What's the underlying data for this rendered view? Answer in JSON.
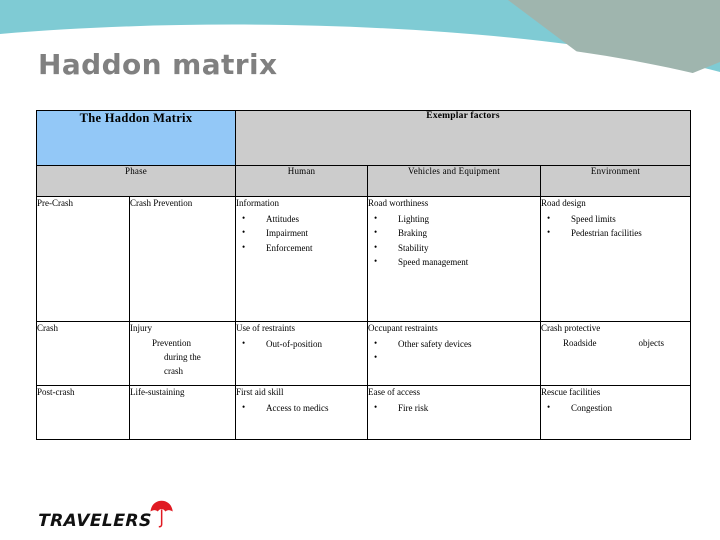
{
  "slide": {
    "title": "Haddon matrix"
  },
  "theme": {
    "teal": "#7FCBD4",
    "sage": "#9FB5AE",
    "taupe": "#CFCABA",
    "header_blue": "#93C8F7",
    "header_gray": "#CCCCCC",
    "title_gray": "#808080",
    "logo_red": "#E01A22"
  },
  "table": {
    "corner_label": "The Haddon Matrix",
    "exemplar_label": "Exemplar factors",
    "subheaders": [
      "Phase",
      "Human",
      "Vehicles and Equipment",
      "Environment"
    ],
    "rows": [
      {
        "phase": "Pre-Crash",
        "phase_detail": "Crash Prevention",
        "human": {
          "head": "Information",
          "bullets": [
            "Attitudes",
            "Impairment",
            "Enforcement"
          ]
        },
        "vehicles": {
          "head": "Road worthiness",
          "bullets": [
            "Lighting",
            "Braking",
            "Stability",
            "Speed management"
          ]
        },
        "environment": {
          "head": "Road design",
          "bullets": [
            "Speed limits",
            "Pedestrian facilities"
          ]
        }
      },
      {
        "phase": "Crash",
        "phase_detail_lines": [
          "Injury",
          "Prevention",
          "during the",
          "crash"
        ],
        "human": {
          "head": "Use of restraints",
          "bullets": [
            "Out-of-position"
          ]
        },
        "vehicles": {
          "head": "Occupant restraints",
          "bullets": [
            "Other safety devices",
            ""
          ]
        },
        "environment": {
          "head": "Crash protective",
          "sub_left": "Roadside",
          "sub_right": "objects"
        }
      },
      {
        "phase": "Post-crash",
        "phase_detail": "Life-sustaining",
        "human": {
          "head": "First aid skill",
          "bullets": [
            "Access to medics"
          ]
        },
        "vehicles": {
          "head": "Ease of access",
          "bullets": [
            "Fire risk"
          ]
        },
        "environment": {
          "head": "Rescue facilities",
          "bullets": [
            "Congestion"
          ]
        }
      }
    ]
  },
  "logo": {
    "wordmark": "TRAVELERS",
    "icon": "red-umbrella-icon"
  }
}
